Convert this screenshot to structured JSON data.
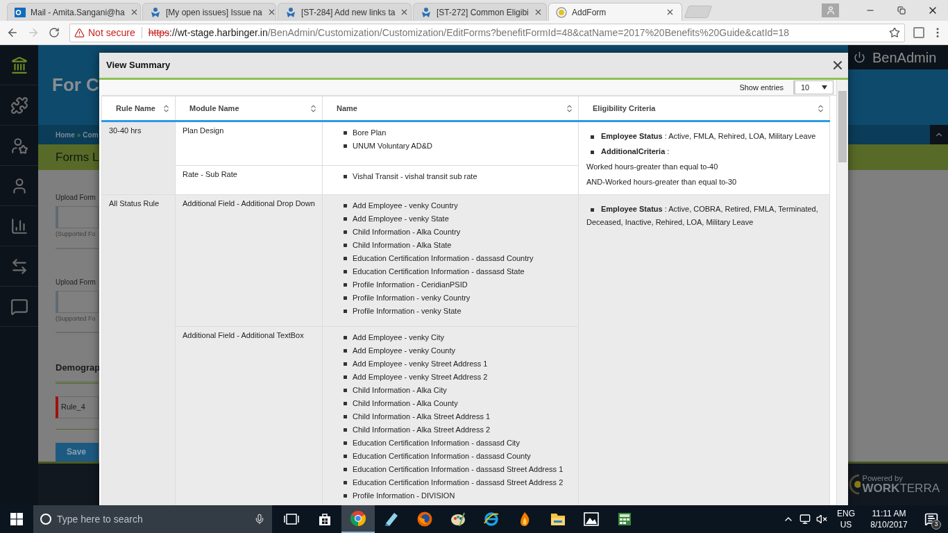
{
  "browser": {
    "tabs": [
      {
        "title": "Mail - Amita.Sangani@ha",
        "kind": "outlook",
        "selected": false
      },
      {
        "title": "[My open issues] Issue na",
        "kind": "jira",
        "selected": false
      },
      {
        "title": "[ST-284] Add new links ta",
        "kind": "jira",
        "selected": false
      },
      {
        "title": "[ST-272] Common Eligibi",
        "kind": "jira",
        "selected": false
      },
      {
        "title": "AddForm",
        "kind": "site",
        "selected": true
      }
    ],
    "nav_buttons": [
      {
        "kind": "back",
        "disabled": false
      },
      {
        "kind": "forward",
        "disabled": true
      },
      {
        "kind": "reload",
        "disabled": false
      }
    ],
    "security": "Not secure",
    "url": {
      "scheme": "https",
      "host": "://wt-stage.harbinger.in",
      "path": "/BenAdmin/Customization/Customization/EditForms?benefitFormId=48&catName=2017%20Benefits%20Guide&catId=18"
    }
  },
  "app": {
    "nav_items": [
      {
        "kind": "home",
        "selected": true
      },
      {
        "kind": "puzzle",
        "selected": false
      },
      {
        "kind": "user-star",
        "selected": false
      },
      {
        "kind": "user",
        "selected": false
      },
      {
        "kind": "chart",
        "selected": false
      },
      {
        "kind": "transfer",
        "selected": false
      },
      {
        "kind": "chat",
        "selected": false
      }
    ],
    "brand": "BenAdmin",
    "page_title": "For C",
    "breadcrumb": [
      "Home",
      "Com"
    ],
    "breadcrumb_separator": "»",
    "section_title": "Forms L",
    "upload_fields": [
      {
        "label": "Upload Form",
        "hint": "(Supported Fo"
      },
      {
        "label": "Upload Form",
        "hint": "(Supported Fo"
      }
    ],
    "section_heading": "Demograp",
    "rule_field": "Rule_4",
    "save_button": "Save",
    "powered_by": "Powered by",
    "footer_brand": {
      "bold": "WORK",
      "light": "TERRA"
    }
  },
  "modal": {
    "title": "View Summary",
    "show_entries_label": "Show entries",
    "page_size": "10",
    "table": {
      "columns": [
        "Rule Name",
        "Module Name",
        "Name",
        "Eligibility Criteria"
      ],
      "rules": [
        {
          "rule_name": "30-40 hrs",
          "modules": [
            {
              "module": "Plan Design",
              "names": [
                "Bore Plan",
                "UNUM Voluntary AD&D"
              ]
            },
            {
              "module": "Rate - Sub Rate",
              "names": [
                "Vishal Transit - vishal transit sub rate"
              ]
            }
          ],
          "eligibility": [
            {
              "kind": "criterion",
              "text": "**Employee Status** : Active, FMLA, Rehired, LOA, Military Leave"
            },
            {
              "kind": "criterion",
              "text": "**AdditionalCriteria** :"
            },
            {
              "kind": "line",
              "text": "Worked hours-greater than equal to-40"
            },
            {
              "kind": "line",
              "text": "AND-Worked hours-greater than equal to-30"
            }
          ]
        },
        {
          "rule_name": "All Status Rule",
          "modules": [
            {
              "module": "Additional Field - Additional Drop Down",
              "names": [
                "Add Employee - venky Country",
                "Add Employee - venky State",
                "Child Information - Alka Country",
                "Child Information - Alka State",
                "Education Certification Information - dassasd Country",
                "Education Certification Information - dassasd State",
                "Profile Information - CeridianPSID",
                "Profile Information - venky Country",
                "Profile Information - venky State"
              ]
            },
            {
              "module": "Additional Field - Additional TextBox",
              "names": [
                "Add Employee - venky City",
                "Add Employee - venky County",
                "Add Employee - venky Street Address 1",
                "Add Employee - venky Street Address 2",
                "Child Information - Alka City",
                "Child Information - Alka County",
                "Child Information - Alka Street Address 1",
                "Child Information - Alka Street Address 2",
                "Education Certification Information - dassasd City",
                "Education Certification Information - dassasd County",
                "Education Certification Information - dassasd Street Address 1",
                "Education Certification Information - dassasd Street Address 2",
                "Profile Information - DIVISION"
              ]
            }
          ],
          "eligibility": [
            {
              "kind": "criterion",
              "text": "**Employee Status** : Active, COBRA, Retired, FMLA, Terminated, Deceased, Inactive, Rehired, LOA, Military Leave"
            }
          ]
        }
      ]
    }
  },
  "taskbar": {
    "search_placeholder": "Type here to search",
    "apps": [
      {
        "kind": "taskview",
        "selected": false
      },
      {
        "kind": "store",
        "selected": false
      },
      {
        "kind": "chrome",
        "selected": true
      },
      {
        "kind": "notepad",
        "selected": false
      },
      {
        "kind": "firefox",
        "selected": false
      },
      {
        "kind": "paint",
        "selected": false
      },
      {
        "kind": "ie",
        "selected": false
      },
      {
        "kind": "flame",
        "selected": false
      },
      {
        "kind": "folder",
        "selected": false
      },
      {
        "kind": "photos",
        "selected": false
      },
      {
        "kind": "calc",
        "selected": false
      }
    ],
    "language": [
      "ENG",
      "US"
    ],
    "time": "11:11 AM",
    "date": "8/10/2017",
    "notification_count": "3"
  }
}
